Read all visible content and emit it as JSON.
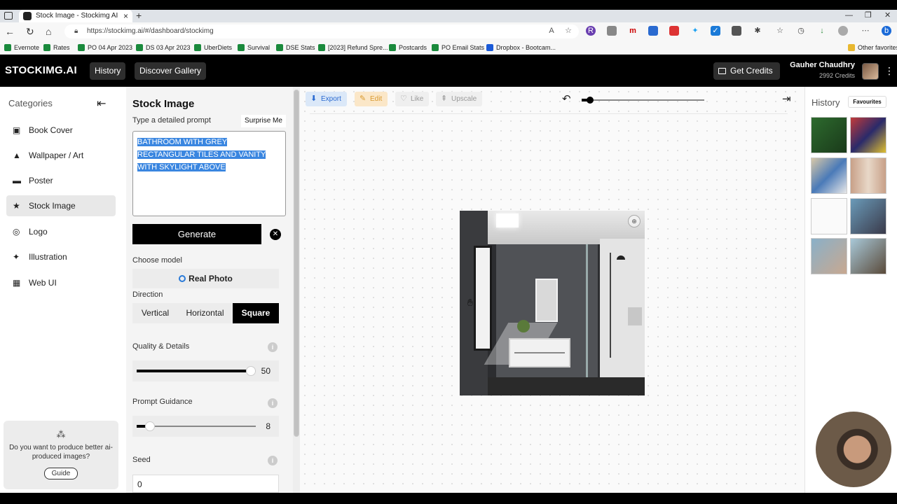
{
  "browser": {
    "tab_title": "Stock Image - Stockimg AI",
    "new_tab": "+",
    "url": "https://stockimg.ai/#/dashboard/stockimg",
    "bookmarks": [
      "Evernote",
      "Rates",
      "PO 04 Apr 2023",
      "DS 03 Apr 2023",
      "UberDiets",
      "Survival",
      "DSE Stats",
      "[2023] Refund Spre...",
      "Postcards",
      "PO Email Stats",
      "Dropbox - Bootcam..."
    ],
    "other_favorites": "Other favorites"
  },
  "header": {
    "logo": "STOCKIMG.AI",
    "history": "History",
    "discover": "Discover Gallery",
    "get_credits": "Get Credits",
    "user_name": "Gauher Chaudhry",
    "credits": "2992 Credits"
  },
  "categories": {
    "title": "Categories",
    "items": [
      {
        "label": "Book Cover",
        "icon": "book-icon"
      },
      {
        "label": "Wallpaper / Art",
        "icon": "image-icon"
      },
      {
        "label": "Poster",
        "icon": "poster-icon"
      },
      {
        "label": "Stock Image",
        "icon": "star-icon"
      },
      {
        "label": "Logo",
        "icon": "logo-icon"
      },
      {
        "label": "Illustration",
        "icon": "sparkle-icon"
      },
      {
        "label": "Web UI",
        "icon": "grid-icon"
      }
    ],
    "active": "Stock Image",
    "guide_text": "Do you want to produce better ai-produced images?",
    "guide_button": "Guide"
  },
  "form": {
    "title": "Stock Image",
    "prompt_label": "Type a detailed prompt",
    "surprise": "Surprise Me",
    "prompt_value": "BATHROOM WITH GREY RECTANGULAR TILES AND VANITY WITH SKYLIGHT ABOVE",
    "generate": "Generate",
    "model_label": "Choose model",
    "model_value": "Real Photo",
    "direction_label": "Direction",
    "directions": [
      "Vertical",
      "Horizontal",
      "Square"
    ],
    "direction_selected": "Square",
    "quality_label": "Quality & Details",
    "quality_value": "50",
    "guidance_label": "Prompt Guidance",
    "guidance_value": "8",
    "seed_label": "Seed",
    "seed_value": "0"
  },
  "toolbar": {
    "export": "Export",
    "edit": "Edit",
    "like": "Like",
    "upscale": "Upscale"
  },
  "history_panel": {
    "title": "History",
    "favourites": "Favourites"
  },
  "colors": {
    "accent_blue": "#3a86e0",
    "export_bg": "#dbe8f8",
    "edit_bg": "#fbe7c8"
  }
}
